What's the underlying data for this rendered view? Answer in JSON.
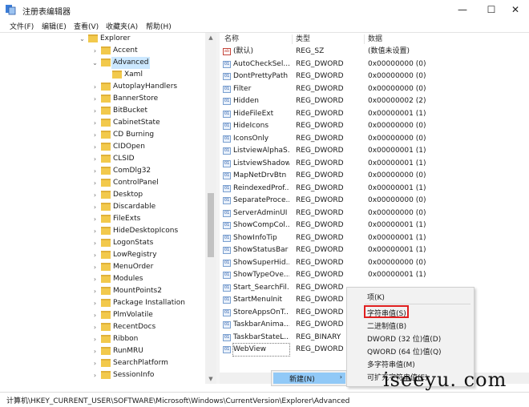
{
  "window": {
    "title": "注册表编辑器",
    "minimize": "—",
    "maximize": "☐",
    "close": "✕"
  },
  "menubar": [
    "文件(F)",
    "编辑(E)",
    "查看(V)",
    "收藏夹(A)",
    "帮助(H)"
  ],
  "tree": {
    "items": [
      {
        "label": "Explorer",
        "expanded": true,
        "depth": 0
      },
      {
        "label": "Accent",
        "depth": 1
      },
      {
        "label": "Advanced",
        "depth": 1,
        "expanded": true,
        "selected": true
      },
      {
        "label": "Xaml",
        "depth": 2
      },
      {
        "label": "AutoplayHandlers",
        "depth": 1
      },
      {
        "label": "BannerStore",
        "depth": 1
      },
      {
        "label": "BitBucket",
        "depth": 1
      },
      {
        "label": "CabinetState",
        "depth": 1
      },
      {
        "label": "CD Burning",
        "depth": 1
      },
      {
        "label": "CIDOpen",
        "depth": 1
      },
      {
        "label": "CLSID",
        "depth": 1
      },
      {
        "label": "ComDlg32",
        "depth": 1
      },
      {
        "label": "ControlPanel",
        "depth": 1
      },
      {
        "label": "Desktop",
        "depth": 1
      },
      {
        "label": "Discardable",
        "depth": 1
      },
      {
        "label": "FileExts",
        "depth": 1
      },
      {
        "label": "HideDesktopIcons",
        "depth": 1
      },
      {
        "label": "LogonStats",
        "depth": 1
      },
      {
        "label": "LowRegistry",
        "depth": 1
      },
      {
        "label": "MenuOrder",
        "depth": 1
      },
      {
        "label": "Modules",
        "depth": 1
      },
      {
        "label": "MountPoints2",
        "depth": 1
      },
      {
        "label": "Package Installation",
        "depth": 1
      },
      {
        "label": "PlmVolatile",
        "depth": 1
      },
      {
        "label": "RecentDocs",
        "depth": 1
      },
      {
        "label": "Ribbon",
        "depth": 1
      },
      {
        "label": "RunMRU",
        "depth": 1
      },
      {
        "label": "SearchPlatform",
        "depth": 1
      },
      {
        "label": "SessionInfo",
        "depth": 1
      }
    ]
  },
  "list": {
    "headers": {
      "name": "名称",
      "type": "类型",
      "data": "数据"
    },
    "rows": [
      {
        "name": "(默认)",
        "type": "REG_SZ",
        "data": "(数值未设置)",
        "kind": "sz"
      },
      {
        "name": "AutoCheckSel...",
        "type": "REG_DWORD",
        "data": "0x00000000 (0)"
      },
      {
        "name": "DontPrettyPath",
        "type": "REG_DWORD",
        "data": "0x00000000 (0)"
      },
      {
        "name": "Filter",
        "type": "REG_DWORD",
        "data": "0x00000000 (0)"
      },
      {
        "name": "Hidden",
        "type": "REG_DWORD",
        "data": "0x00000002 (2)"
      },
      {
        "name": "HideFileExt",
        "type": "REG_DWORD",
        "data": "0x00000001 (1)"
      },
      {
        "name": "HideIcons",
        "type": "REG_DWORD",
        "data": "0x00000000 (0)"
      },
      {
        "name": "IconsOnly",
        "type": "REG_DWORD",
        "data": "0x00000000 (0)"
      },
      {
        "name": "ListviewAlphaS...",
        "type": "REG_DWORD",
        "data": "0x00000001 (1)"
      },
      {
        "name": "ListviewShadow",
        "type": "REG_DWORD",
        "data": "0x00000001 (1)"
      },
      {
        "name": "MapNetDrvBtn",
        "type": "REG_DWORD",
        "data": "0x00000000 (0)"
      },
      {
        "name": "ReindexedProf...",
        "type": "REG_DWORD",
        "data": "0x00000001 (1)"
      },
      {
        "name": "SeparateProce...",
        "type": "REG_DWORD",
        "data": "0x00000000 (0)"
      },
      {
        "name": "ServerAdminUI",
        "type": "REG_DWORD",
        "data": "0x00000000 (0)"
      },
      {
        "name": "ShowCompCol...",
        "type": "REG_DWORD",
        "data": "0x00000001 (1)"
      },
      {
        "name": "ShowInfoTip",
        "type": "REG_DWORD",
        "data": "0x00000001 (1)"
      },
      {
        "name": "ShowStatusBar",
        "type": "REG_DWORD",
        "data": "0x00000001 (1)"
      },
      {
        "name": "ShowSuperHid...",
        "type": "REG_DWORD",
        "data": "0x00000000 (0)"
      },
      {
        "name": "ShowTypeOve...",
        "type": "REG_DWORD",
        "data": "0x00000001 (1)"
      },
      {
        "name": "Start_SearchFil...",
        "type": "REG_DWORD",
        "data": ""
      },
      {
        "name": "StartMenuInit",
        "type": "REG_DWORD",
        "data": ""
      },
      {
        "name": "StoreAppsOnT...",
        "type": "REG_DWORD",
        "data": ""
      },
      {
        "name": "TaskbarAnima...",
        "type": "REG_DWORD",
        "data": ""
      },
      {
        "name": "TaskbarStateL...",
        "type": "REG_BINARY",
        "data": ""
      },
      {
        "name": "WebView",
        "type": "REG_DWORD",
        "data": "",
        "selected": true
      }
    ]
  },
  "context_menu": {
    "new_label": "新建(N)",
    "arrow": "›"
  },
  "submenu": {
    "items": [
      "项(K)",
      "字符串值(S)",
      "二进制值(B)",
      "DWORD (32 位)值(D)",
      "QWORD (64 位)值(Q)",
      "多字符串值(M)",
      "可扩充字符串值(E)"
    ],
    "highlighted_index": 1,
    "highlight_color": "#e02020"
  },
  "statusbar": {
    "path": "计算机\\HKEY_CURRENT_USER\\SOFTWARE\\Microsoft\\Windows\\CurrentVersion\\Explorer\\Advanced"
  },
  "watermark": "iseeyu. com"
}
